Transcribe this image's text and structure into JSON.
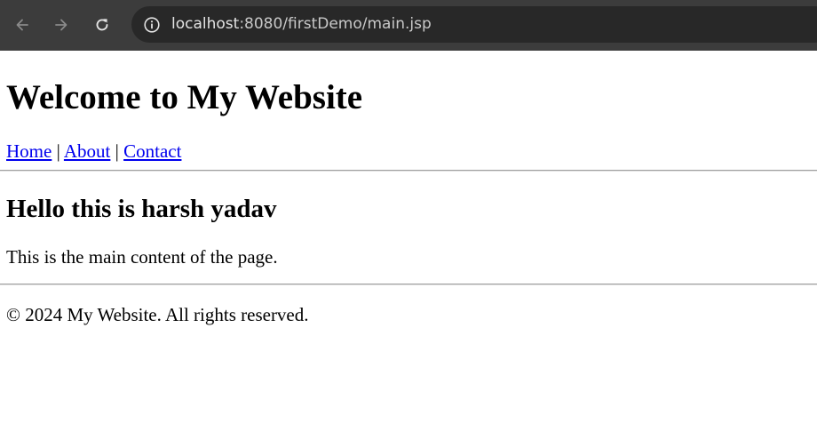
{
  "browser": {
    "back_icon": "arrow-left-icon",
    "forward_icon": "arrow-right-icon",
    "reload_icon": "reload-icon",
    "site_info_icon": "info-icon",
    "url_host": "localhost",
    "url_path": ":8080/firstDemo/main.jsp"
  },
  "page": {
    "title": "Welcome to My Website",
    "nav": {
      "home": "Home",
      "separator": "|",
      "about": "About",
      "contact": "Contact"
    },
    "heading": "Hello this is harsh yadav",
    "content": "This is the main content of the page.",
    "footer": "© 2024 My Website. All rights reserved."
  },
  "colors": {
    "toolbar_bg": "#3c3c3c",
    "omnibox_bg": "#282828",
    "link": "#0000ee"
  }
}
